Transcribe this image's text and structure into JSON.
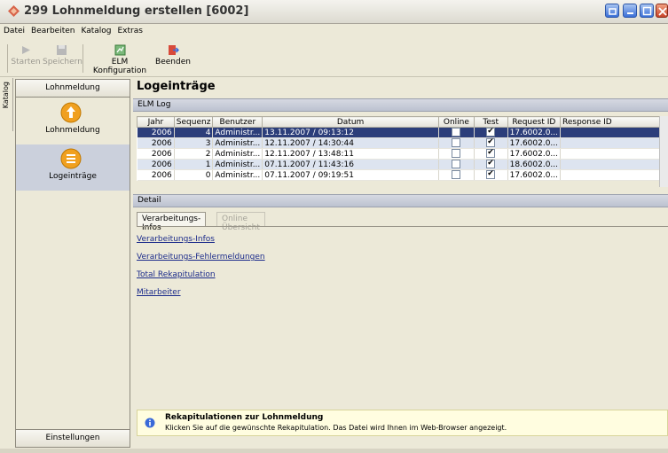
{
  "window": {
    "title": "299 Lohnmeldung erstellen [6002]"
  },
  "menu": [
    "Datei",
    "Bearbeiten",
    "Katalog",
    "Extras"
  ],
  "toolbar": {
    "starten": "Starten",
    "speichern": "Speichern",
    "elm_konfiguration": "ELM Konfiguration",
    "beenden": "Beenden"
  },
  "side_tab": "Katalog",
  "left": {
    "header": "Lohnmeldung",
    "items": [
      {
        "label": "Lohnmeldung",
        "icon": "arrow-up-icon"
      },
      {
        "label": "Logeinträge",
        "icon": "list-icon"
      }
    ],
    "footer": "Einstellungen"
  },
  "main": {
    "title": "Logeinträge",
    "elm_log_label": "ELM Log",
    "detail_label": "Detail"
  },
  "log_table": {
    "columns": [
      "Jahr",
      "Sequenz",
      "Benutzer",
      "Datum",
      "Online",
      "Test",
      "Request ID",
      "Response ID"
    ],
    "rows": [
      {
        "jahr": "2006",
        "sequenz": "4",
        "benutzer": "Administr...",
        "datum": "13.11.2007 / 09:13:12",
        "online": false,
        "test": true,
        "request": "17.6002.0...",
        "response": ""
      },
      {
        "jahr": "2006",
        "sequenz": "3",
        "benutzer": "Administr...",
        "datum": "12.11.2007 / 14:30:44",
        "online": false,
        "test": true,
        "request": "17.6002.0...",
        "response": ""
      },
      {
        "jahr": "2006",
        "sequenz": "2",
        "benutzer": "Administr...",
        "datum": "12.11.2007 / 13:48:11",
        "online": false,
        "test": true,
        "request": "17.6002.0...",
        "response": ""
      },
      {
        "jahr": "2006",
        "sequenz": "1",
        "benutzer": "Administr...",
        "datum": "07.11.2007 / 11:43:16",
        "online": false,
        "test": true,
        "request": "18.6002.0...",
        "response": ""
      },
      {
        "jahr": "2006",
        "sequenz": "0",
        "benutzer": "Administr...",
        "datum": "07.11.2007 / 09:19:51",
        "online": false,
        "test": true,
        "request": "17.6002.0...",
        "response": ""
      }
    ]
  },
  "tabs": [
    "Verarbeitungs-Infos",
    "Online Übersicht"
  ],
  "links": [
    "Verarbeitungs-Infos",
    "Verarbeitungs-Fehlermeldungen",
    "Total Rekapitulation",
    "Mitarbeiter"
  ],
  "info": {
    "title": "Rekapitulationen zur Lohnmeldung",
    "text": "Klicken Sie auf die gewünschte Rekapitulation. Das Datei wird Ihnen im Web-Browser angezeigt."
  },
  "colors": {
    "selection": "#2c3e7a",
    "strip": "#c8ccd8",
    "info_bg": "#fffde0"
  }
}
